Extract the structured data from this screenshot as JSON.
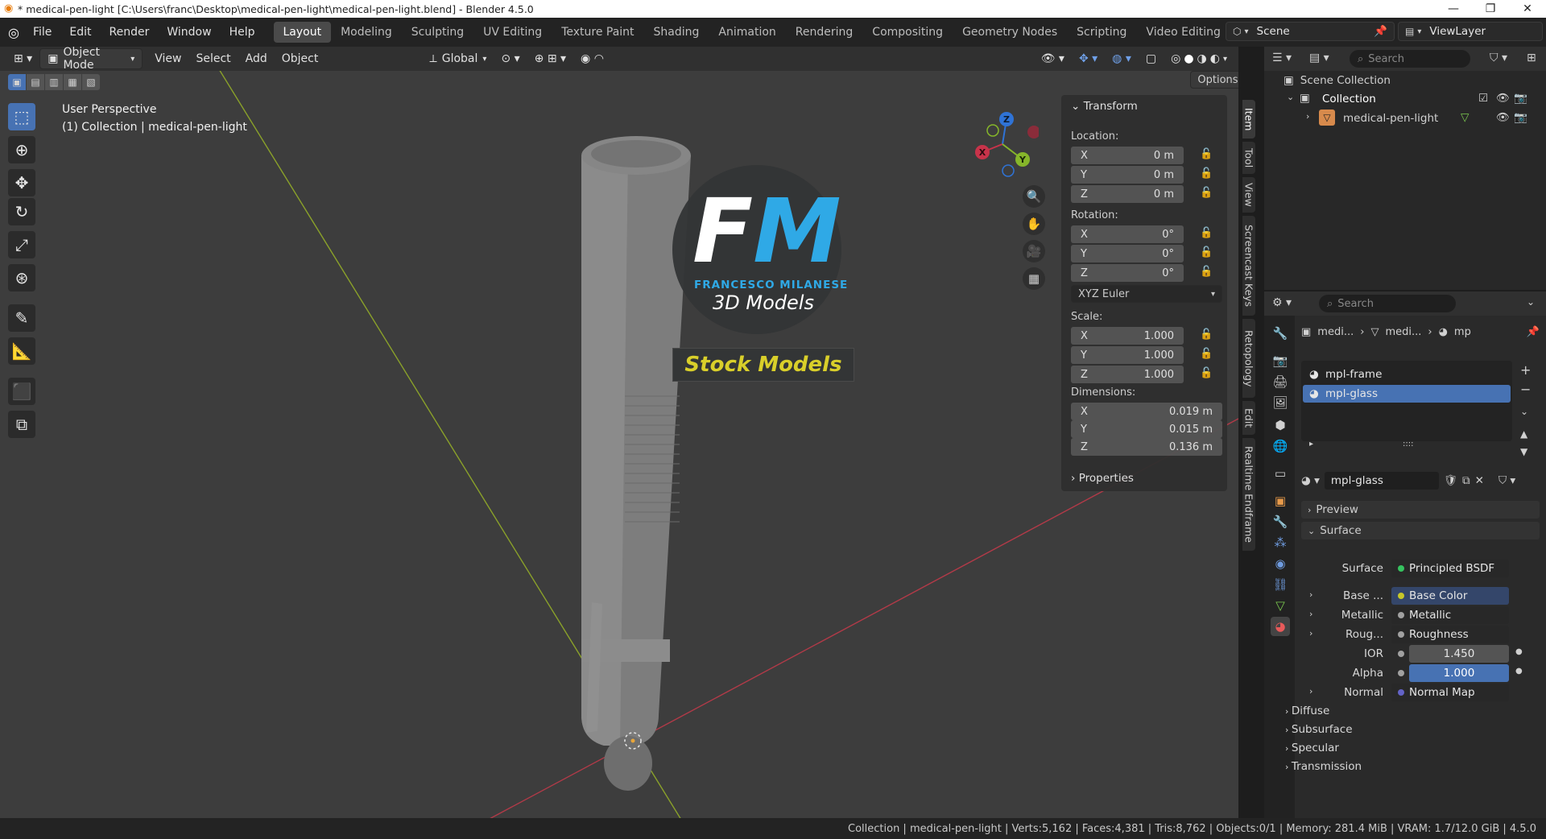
{
  "window": {
    "title": "* medical-pen-light [C:\\Users\\franc\\Desktop\\medical-pen-light\\medical-pen-light.blend] - Blender 4.5.0"
  },
  "menu": [
    "File",
    "Edit",
    "Render",
    "Window",
    "Help"
  ],
  "workspaces": [
    "Layout",
    "Modeling",
    "Sculpting",
    "UV Editing",
    "Texture Paint",
    "Shading",
    "Animation",
    "Rendering",
    "Compositing",
    "Geometry Nodes",
    "Scripting",
    "Video Editing"
  ],
  "active_workspace": "Layout",
  "scene": {
    "name": "Scene",
    "view_layer": "ViewLayer"
  },
  "header3d": {
    "mode": "Object Mode",
    "view": "View",
    "select": "Select",
    "add": "Add",
    "object": "Object",
    "orientation": "Global",
    "options": "Options"
  },
  "overlay_text": {
    "perspective": "User Perspective",
    "collection": "(1) Collection | medical-pen-light"
  },
  "watermark": {
    "logo": "FM",
    "brand": "FRANCESCO MILANESE",
    "subtitle": "3D Models",
    "banner": "Stock Models"
  },
  "gizmo": {
    "x": "X",
    "y": "Y",
    "z": "Z"
  },
  "transform": {
    "title": "Transform",
    "location_label": "Location:",
    "location": [
      {
        "axis": "X",
        "value": "0 m"
      },
      {
        "axis": "Y",
        "value": "0 m"
      },
      {
        "axis": "Z",
        "value": "0 m"
      }
    ],
    "rotation_label": "Rotation:",
    "rotation": [
      {
        "axis": "X",
        "value": "0°"
      },
      {
        "axis": "Y",
        "value": "0°"
      },
      {
        "axis": "Z",
        "value": "0°"
      }
    ],
    "rotation_mode": "XYZ Euler",
    "scale_label": "Scale:",
    "scale": [
      {
        "axis": "X",
        "value": "1.000"
      },
      {
        "axis": "Y",
        "value": "1.000"
      },
      {
        "axis": "Z",
        "value": "1.000"
      }
    ],
    "dimensions_label": "Dimensions:",
    "dimensions": [
      {
        "axis": "X",
        "value": "0.019 m"
      },
      {
        "axis": "Y",
        "value": "0.015 m"
      },
      {
        "axis": "Z",
        "value": "0.136 m"
      }
    ],
    "properties": "Properties"
  },
  "sidebar_tabs": [
    "Item",
    "Tool",
    "View",
    "Screencast Keys",
    "Retopology",
    "Edit",
    "Realtime Endframe"
  ],
  "outliner": {
    "search_placeholder": "Search",
    "scene_collection": "Scene Collection",
    "collection": "Collection",
    "object": "medical-pen-light"
  },
  "properties": {
    "search_placeholder": "Search",
    "breadcrumb": [
      "medi...",
      "medi...",
      "mp"
    ],
    "materials": [
      "mpl-frame",
      "mpl-glass"
    ],
    "selected_material": "mpl-glass",
    "material_name": "mpl-glass",
    "preview": "Preview",
    "surface_section": "Surface",
    "surface_label": "Surface",
    "surface_value": "Principled BSDF",
    "inputs": [
      {
        "label": "Base ...",
        "value": "Base Color",
        "color": "#c7c729"
      },
      {
        "label": "Metallic",
        "value": "Metallic",
        "color": "#a1a1a1"
      },
      {
        "label": "Roug...",
        "value": "Roughness",
        "color": "#a1a1a1"
      }
    ],
    "ior_label": "IOR",
    "ior": "1.450",
    "alpha_label": "Alpha",
    "alpha": "1.000",
    "normal_label": "Normal",
    "normal_value": "Normal Map",
    "subsections": [
      "Diffuse",
      "Subsurface",
      "Specular",
      "Transmission"
    ]
  },
  "status": "Collection | medical-pen-light | Verts:5,162 | Faces:4,381 | Tris:8,762 | Objects:0/1 | Memory: 281.4 MiB | VRAM: 1.7/12.0 GiB | 4.5.0",
  "colors": {
    "accent": "#4772b3",
    "x_axis": "#c8334a",
    "y_axis": "#86b62a",
    "z_axis": "#2f73d6",
    "brand_blue": "#2fa9e6",
    "banner_yellow": "#d9cf2a"
  }
}
